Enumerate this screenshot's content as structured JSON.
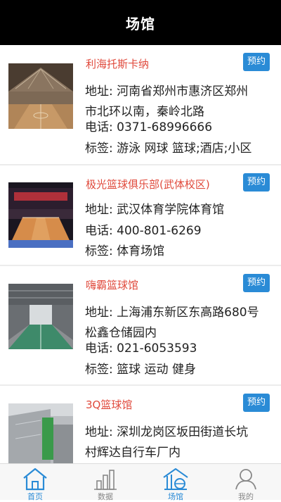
{
  "header": {
    "title": "场馆"
  },
  "venues": [
    {
      "name": "利海托斯卡纳",
      "book_label": "预约",
      "address_lines": [
        "地址: 河南省郑州市惠济区郑州",
        "市北环以南，秦岭北路"
      ],
      "phone": "电话: 0371-68996666",
      "tags": "标签: 游泳 网球 篮球;酒店;小区"
    },
    {
      "name": "极光篮球俱乐部(武体校区)",
      "book_label": "预约",
      "address_lines": [
        "地址: 武汉体育学院体育馆"
      ],
      "phone": "电话: 400-801-6269",
      "tags": "标签: 体育场馆"
    },
    {
      "name": "嗨霸篮球馆",
      "book_label": "预约",
      "address_lines": [
        "地址: 上海浦东新区东高路680号",
        "松鑫仓储园内"
      ],
      "phone": "电话: 021-6053593",
      "tags": "标签: 篮球 运动 健身"
    },
    {
      "name": "3Q篮球馆",
      "book_label": "预约",
      "address_lines": [
        "地址: 深圳龙岗区坂田街道长坑",
        "村辉达自行车厂内"
      ],
      "phone": "",
      "tags": ""
    }
  ],
  "tabbar": {
    "items": [
      {
        "label": "首页",
        "icon": "home-icon",
        "active": true
      },
      {
        "label": "数据",
        "icon": "bar-chart-icon",
        "active": false
      },
      {
        "label": "场馆",
        "icon": "venue-icon",
        "active": true
      },
      {
        "label": "我的",
        "icon": "user-icon",
        "active": false
      }
    ]
  },
  "colors": {
    "header_bg": "#000000",
    "venue_name": "#e04a3c",
    "book_button": "#2a8bd6",
    "tab_active": "#2a8bd6",
    "tab_inactive": "#888888"
  }
}
